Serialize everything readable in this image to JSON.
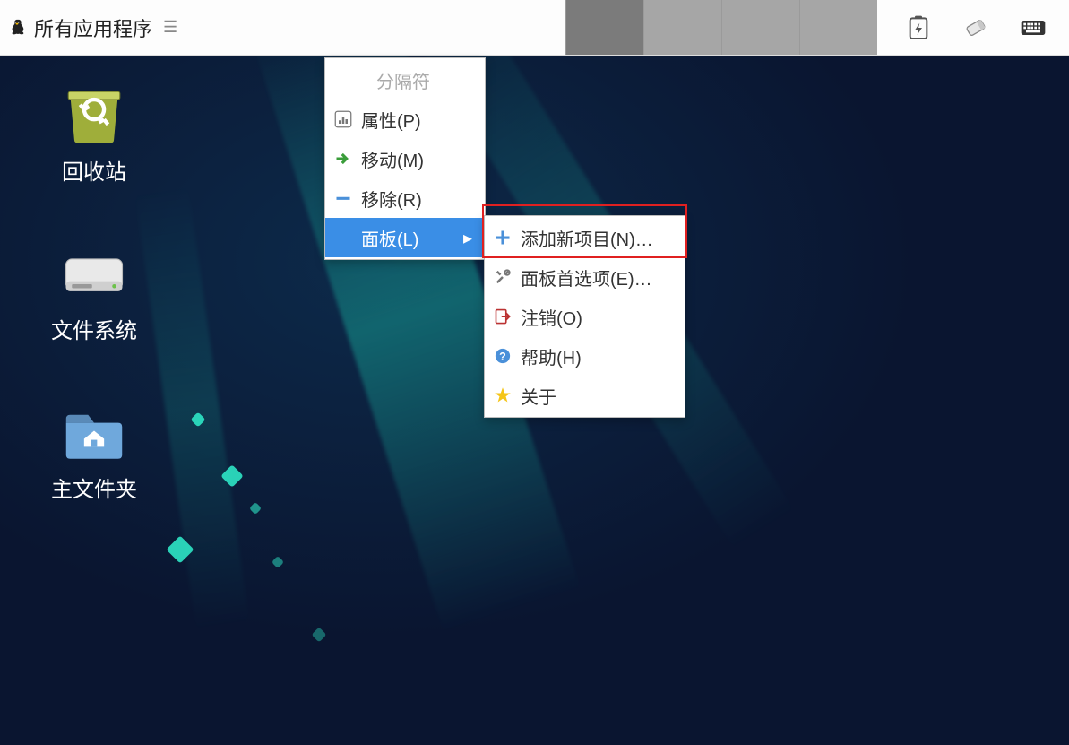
{
  "panel": {
    "app_menu_label": "所有应用程序"
  },
  "desktop_icons": {
    "trash": "回收站",
    "filesystem": "文件系统",
    "home": "主文件夹"
  },
  "context_menu_1": {
    "separator": "分隔符",
    "properties": "属性(P)",
    "move": "移动(M)",
    "remove": "移除(R)",
    "panel": "面板(L)"
  },
  "context_menu_2": {
    "add_item": "添加新项目(N)…",
    "preferences": "面板首选项(E)…",
    "logout": "注销(O)",
    "help": "帮助(H)",
    "about": "关于"
  }
}
